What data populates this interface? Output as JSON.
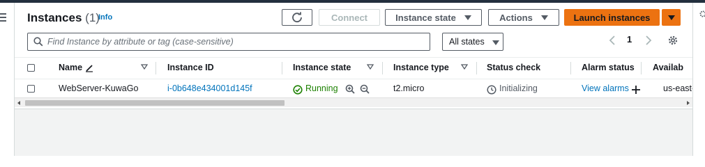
{
  "header": {
    "title": "Instances",
    "count": "(1)",
    "info": "Info"
  },
  "toolbar": {
    "refresh_icon": "refresh-icon",
    "connect": "Connect",
    "instance_state": "Instance state",
    "actions": "Actions",
    "launch": "Launch instances"
  },
  "filter": {
    "placeholder": "Find Instance by attribute or tag (case-sensitive)",
    "states": "All states"
  },
  "pagination": {
    "page": "1"
  },
  "table": {
    "columns": [
      "Name",
      "Instance ID",
      "Instance state",
      "Instance type",
      "Status check",
      "Alarm status",
      "Availab"
    ],
    "rows": [
      {
        "name": "WebServer-KuwaGo",
        "instance_id": "i-0b648e434001d145f",
        "state": "Running",
        "type": "t2.micro",
        "status": "Initializing",
        "alarm": "View alarms",
        "az": "us-east-"
      }
    ]
  },
  "colors": {
    "primary": "#ec7211",
    "link": "#0073bb",
    "success": "#1d8102",
    "topbar": "#232f3e"
  }
}
